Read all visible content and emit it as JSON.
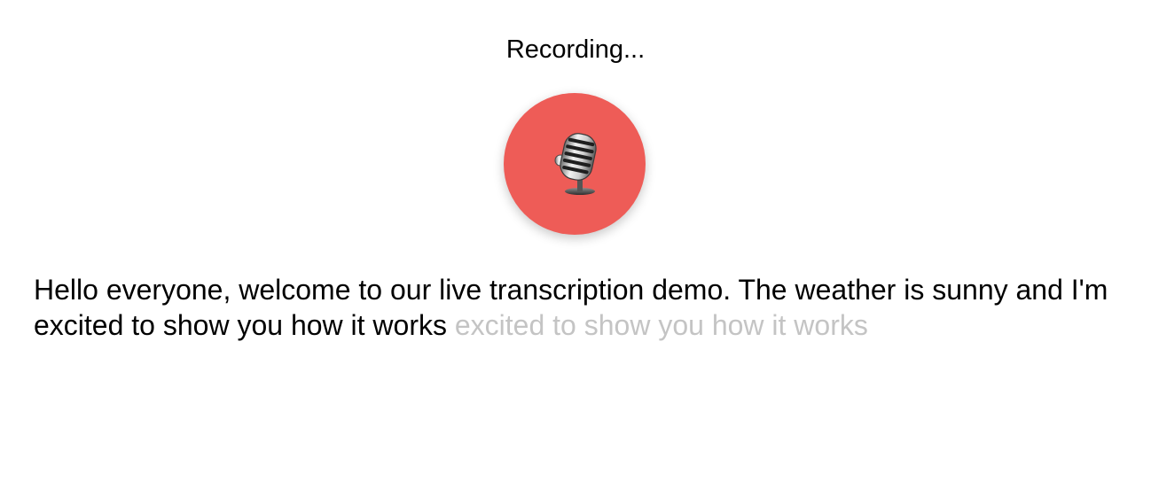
{
  "status": {
    "text": "Recording..."
  },
  "record_button": {
    "icon": "microphone-icon",
    "color": "#ee5c57"
  },
  "transcript": {
    "final_text": "Hello everyone, welcome to our live transcription demo. The weather is sunny and I'm excited to show you how it works",
    "interim_text": "excited to show you how it works",
    "final_color": "#000000",
    "interim_color": "#c4c4c4"
  }
}
